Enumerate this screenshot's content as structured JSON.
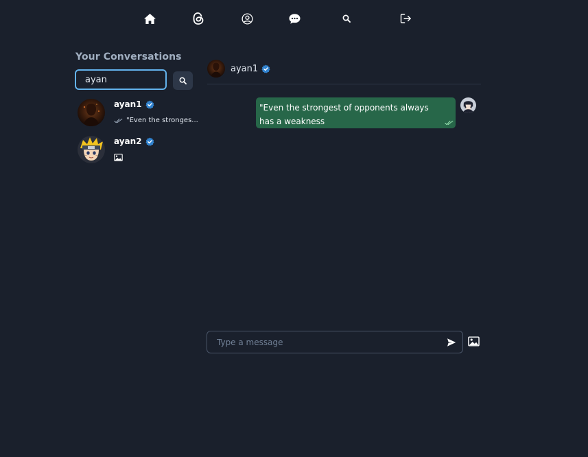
{
  "nav": {
    "icons": [
      "home-icon",
      "threads-logo-icon",
      "profile-icon",
      "chat-icon",
      "search-icon",
      "logout-icon"
    ]
  },
  "sidebar": {
    "title": "Your Conversations",
    "search": {
      "value": "ayan",
      "placeholder": ""
    },
    "conversations": [
      {
        "name": "ayan1",
        "verified": true,
        "last_message": "\"Even the stronges...",
        "last_type": "text",
        "seen": true
      },
      {
        "name": "ayan2",
        "verified": true,
        "last_message": "",
        "last_type": "image",
        "seen": false
      }
    ]
  },
  "chat": {
    "header": {
      "name": "ayan1",
      "verified": true
    },
    "messages": [
      {
        "from": "me",
        "text": "\"Even the strongest of opponents always has a weakness",
        "seen": true
      }
    ],
    "composer": {
      "placeholder": "Type a message",
      "value": ""
    }
  },
  "colors": {
    "background": "#1a202c",
    "accent": "#63b3ed",
    "verified": "#3182ce",
    "bubble": "#276749",
    "muted": "#a0aec0"
  }
}
